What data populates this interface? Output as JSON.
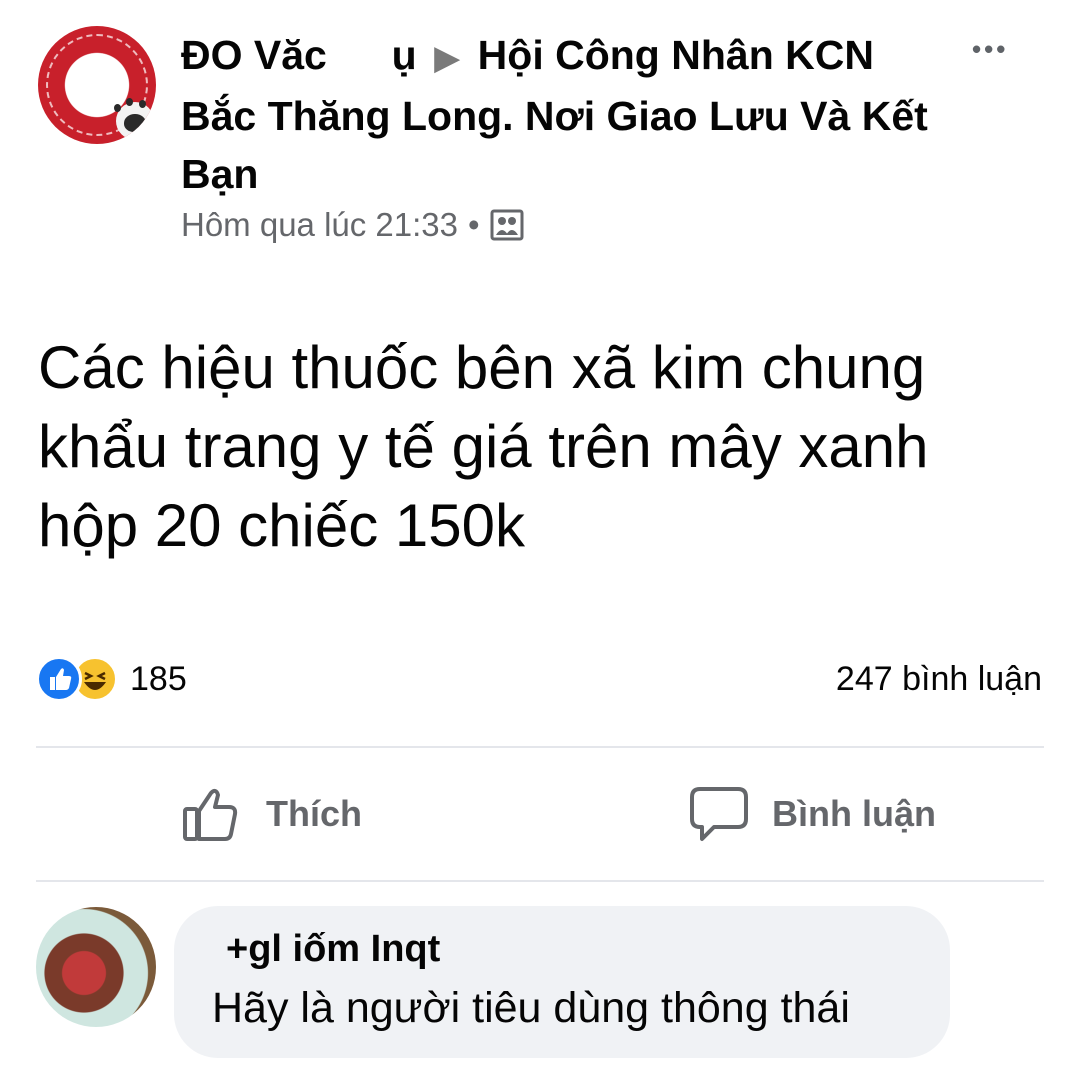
{
  "post": {
    "author_and_group": {
      "author": "ĐO Văc",
      "author_partial": "ụ",
      "group": "Hội Công Nhân KCN Bắc Thăng Long. Nơi Giao Lưu Và Kết Bạn"
    },
    "more_label": "•••",
    "timestamp": "Hôm qua lúc 21:33",
    "separator": "•",
    "audience_icon": "group-audience-icon",
    "text": "Các hiệu thuốc bên xã kim chung khẩu trang y tế giá trên mây xanh hộp 20 chiếc 150k"
  },
  "stats": {
    "reaction_types": [
      "like",
      "haha"
    ],
    "reaction_count": "185",
    "comment_count_label": "247 bình luận"
  },
  "actions": {
    "like_label": "Thích",
    "comment_label": "Bình luận"
  },
  "comment": {
    "author": "+gl iốm Inqt",
    "text": "Hãy là người tiêu dùng thông thái"
  },
  "colors": {
    "like_blue": "#1877f2",
    "haha_yellow": "#f7c22f",
    "secondary_text": "#65676b",
    "bubble_bg": "#f0f2f5"
  }
}
